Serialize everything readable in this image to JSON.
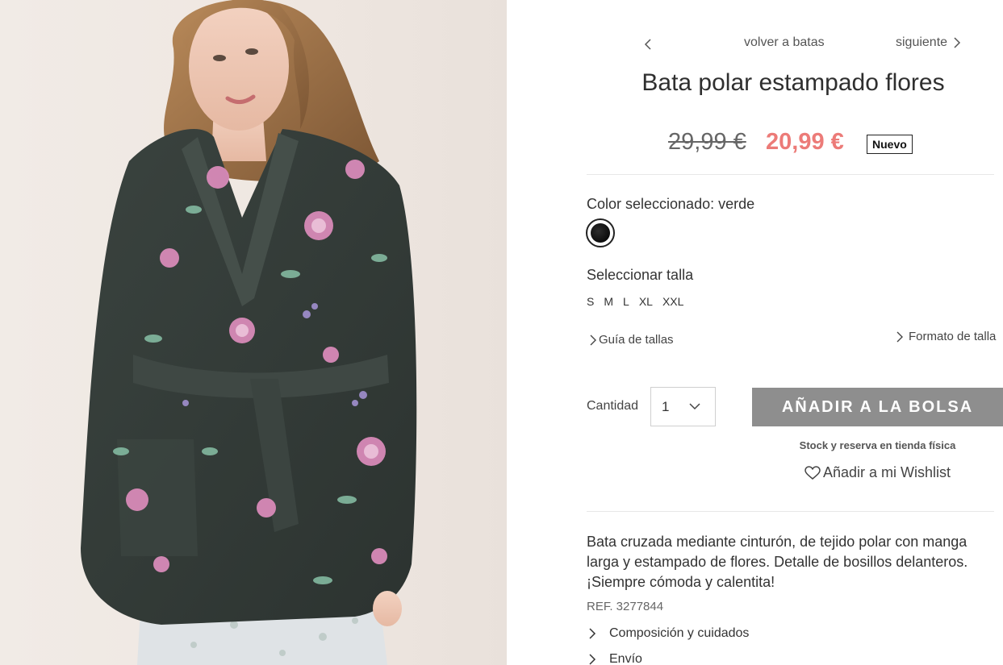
{
  "navigation": {
    "back_label": "volver a batas",
    "next_label": "siguiente"
  },
  "product": {
    "title": "Bata polar estampado flores",
    "old_price": "29,99 €",
    "new_price": "20,99 €",
    "badge": "Nuevo",
    "color_label": "Color seleccionado: verde",
    "size_label": "Seleccionar talla",
    "sizes": [
      "S",
      "M",
      "L",
      "XL",
      "XXL"
    ],
    "size_guide_label": "Guía de tallas",
    "size_format_label": "Formato de talla",
    "quantity_label": "Cantidad",
    "quantity_value": "1",
    "add_to_bag_label": "AÑADIR A LA BOLSA",
    "stock_label": "Stock y reserva en tienda física",
    "wishlist_label": "Añadir a mi Wishlist",
    "description": "Bata cruzada mediante cinturón, de tejido polar con manga larga y estampado de flores. Detalle de bosillos delanteros. ¡Siempre cómoda y calentita!",
    "ref": "REF. 3277844",
    "accordions": [
      "Composición y cuidados",
      "Envío"
    ]
  },
  "colors": {
    "sale_price": "#ec7b78",
    "button_bg": "#8e8e8e",
    "swatch": "#111111"
  },
  "icons": {
    "prev": "chevron-left-icon",
    "next": "chevron-right-icon",
    "dropdown": "chevron-down-icon",
    "wishlist": "heart-icon"
  }
}
